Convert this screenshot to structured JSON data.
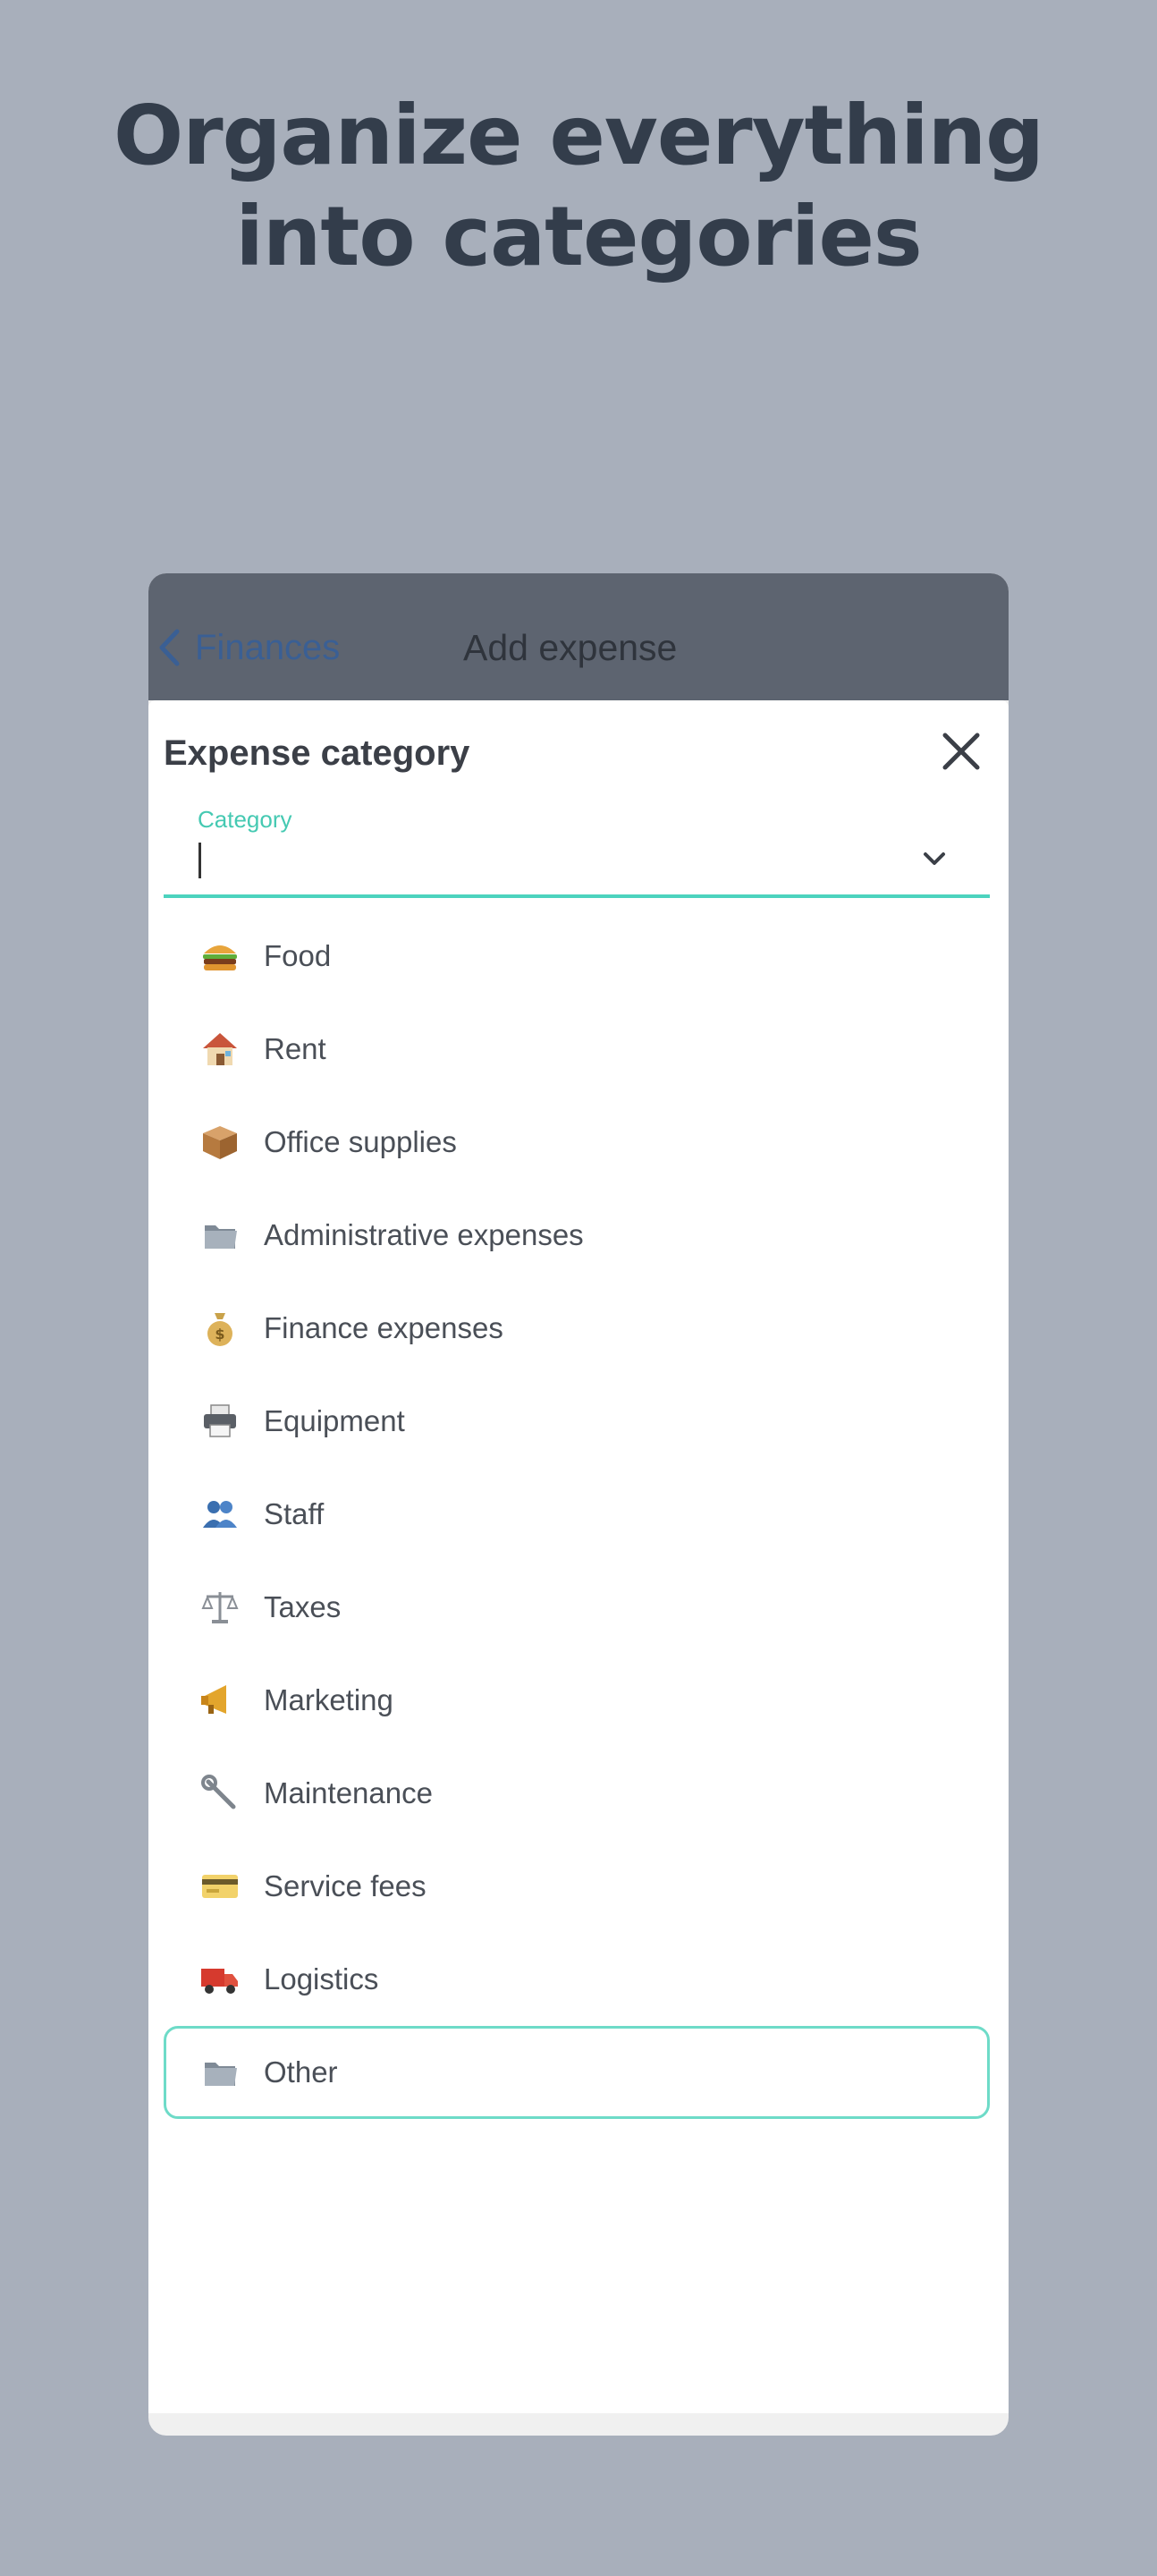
{
  "headline": {
    "line1": "Organize everything",
    "line2": "into categories"
  },
  "app_header": {
    "back_label": "Finances",
    "title": "Add expense"
  },
  "sheet": {
    "title": "Expense category",
    "field": {
      "label": "Category",
      "value": "",
      "placeholder": ""
    },
    "selected_item": "Other",
    "items": [
      {
        "label": "Food",
        "icon": "burger-icon"
      },
      {
        "label": "Rent",
        "icon": "house-icon"
      },
      {
        "label": "Office supplies",
        "icon": "package-icon"
      },
      {
        "label": "Administrative expenses",
        "icon": "folder-icon"
      },
      {
        "label": "Finance expenses",
        "icon": "money-bag-icon"
      },
      {
        "label": "Equipment",
        "icon": "printer-icon"
      },
      {
        "label": "Staff",
        "icon": "people-icon"
      },
      {
        "label": "Taxes",
        "icon": "scales-icon"
      },
      {
        "label": "Marketing",
        "icon": "megaphone-icon"
      },
      {
        "label": "Maintenance",
        "icon": "wrench-icon"
      },
      {
        "label": "Service fees",
        "icon": "credit-card-icon"
      },
      {
        "label": "Logistics",
        "icon": "truck-icon"
      },
      {
        "label": "Other",
        "icon": "folder-icon"
      }
    ]
  },
  "colors": {
    "background": "#a8afbb",
    "headline": "#333d4b",
    "header_bg": "#5d6470",
    "back_link": "#3a5f94",
    "accent": "#4cd3be",
    "selected_border": "#6edbc8",
    "item_text": "#4a4f57"
  }
}
